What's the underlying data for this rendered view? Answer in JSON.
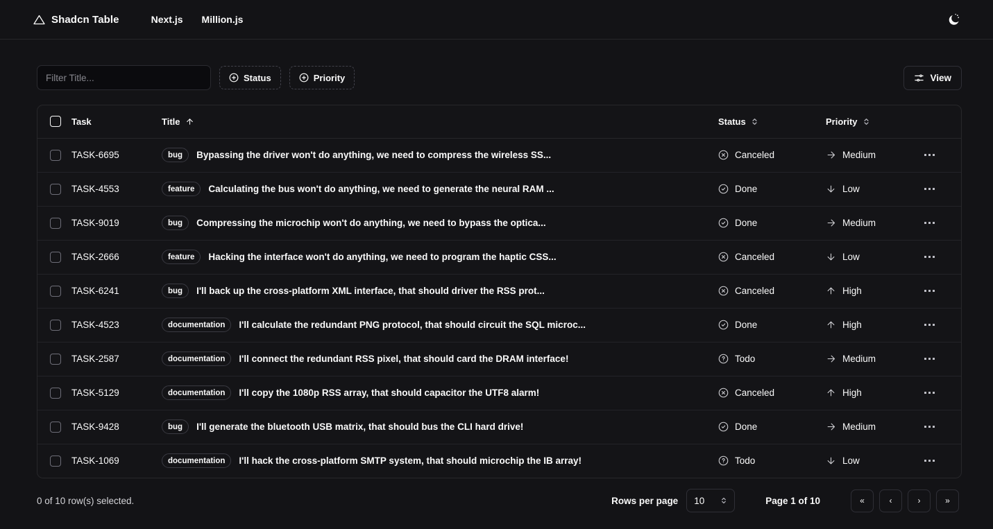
{
  "header": {
    "logo_icon": "triangle-icon",
    "brand_title": "Shadcn Table",
    "nav": [
      {
        "label": "Next.js"
      },
      {
        "label": "Million.js"
      }
    ],
    "theme_toggle_icon": "moon-stars-icon"
  },
  "toolbar": {
    "filter_placeholder": "Filter Title...",
    "filter_value": "",
    "status_facet_label": "Status",
    "priority_facet_label": "Priority",
    "view_label": "View",
    "view_icon": "sliders-icon",
    "facet_icon": "plus-circle-icon"
  },
  "table": {
    "columns": {
      "task": "Task",
      "title": "Title",
      "status": "Status",
      "priority": "Priority"
    },
    "sort": {
      "title_icon": "arrow-up-icon",
      "status_icon": "chevron-up-down-icon",
      "priority_icon": "chevron-up-down-icon"
    },
    "rows": [
      {
        "task": "TASK-6695",
        "label": "bug",
        "title": "Bypassing the driver won't do anything, we need to compress the wireless SS...",
        "status": "Canceled",
        "status_icon": "circle-x-icon",
        "priority": "Medium",
        "priority_icon": "arrow-right-icon"
      },
      {
        "task": "TASK-4553",
        "label": "feature",
        "title": "Calculating the bus won't do anything, we need to generate the neural RAM ...",
        "status": "Done",
        "status_icon": "circle-check-icon",
        "priority": "Low",
        "priority_icon": "arrow-down-icon"
      },
      {
        "task": "TASK-9019",
        "label": "bug",
        "title": "Compressing the microchip won't do anything, we need to bypass the optica...",
        "status": "Done",
        "status_icon": "circle-check-icon",
        "priority": "Medium",
        "priority_icon": "arrow-right-icon"
      },
      {
        "task": "TASK-2666",
        "label": "feature",
        "title": "Hacking the interface won't do anything, we need to program the haptic CSS...",
        "status": "Canceled",
        "status_icon": "circle-x-icon",
        "priority": "Low",
        "priority_icon": "arrow-down-icon"
      },
      {
        "task": "TASK-6241",
        "label": "bug",
        "title": "I'll back up the cross-platform XML interface, that should driver the RSS prot...",
        "status": "Canceled",
        "status_icon": "circle-x-icon",
        "priority": "High",
        "priority_icon": "arrow-up-icon"
      },
      {
        "task": "TASK-4523",
        "label": "documentation",
        "title": "I'll calculate the redundant PNG protocol, that should circuit the SQL microc...",
        "status": "Done",
        "status_icon": "circle-check-icon",
        "priority": "High",
        "priority_icon": "arrow-up-icon"
      },
      {
        "task": "TASK-2587",
        "label": "documentation",
        "title": "I'll connect the redundant RSS pixel, that should card the DRAM interface!",
        "status": "Todo",
        "status_icon": "circle-question-icon",
        "priority": "Medium",
        "priority_icon": "arrow-right-icon"
      },
      {
        "task": "TASK-5129",
        "label": "documentation",
        "title": "I'll copy the 1080p RSS array, that should capacitor the UTF8 alarm!",
        "status": "Canceled",
        "status_icon": "circle-x-icon",
        "priority": "High",
        "priority_icon": "arrow-up-icon"
      },
      {
        "task": "TASK-9428",
        "label": "bug",
        "title": "I'll generate the bluetooth USB matrix, that should bus the CLI hard drive!",
        "status": "Done",
        "status_icon": "circle-check-icon",
        "priority": "Medium",
        "priority_icon": "arrow-right-icon"
      },
      {
        "task": "TASK-1069",
        "label": "documentation",
        "title": "I'll hack the cross-platform SMTP system, that should microchip the IB array!",
        "status": "Todo",
        "status_icon": "circle-question-icon",
        "priority": "Low",
        "priority_icon": "arrow-down-icon"
      }
    ],
    "row_action_icon": "ellipsis-horizontal-icon"
  },
  "footer": {
    "rows_selected": "0 of 10 row(s) selected.",
    "rows_per_page_label": "Rows per page",
    "rows_per_page_value": "10",
    "page_indicator": "Page 1 of 10",
    "pager": {
      "first": "«",
      "prev": "‹",
      "next": "›",
      "last": "»"
    }
  },
  "colors": {
    "background": "#131316",
    "card": "#141417",
    "border": "#27272a",
    "text": "#fafafa",
    "muted": "#86868d"
  }
}
